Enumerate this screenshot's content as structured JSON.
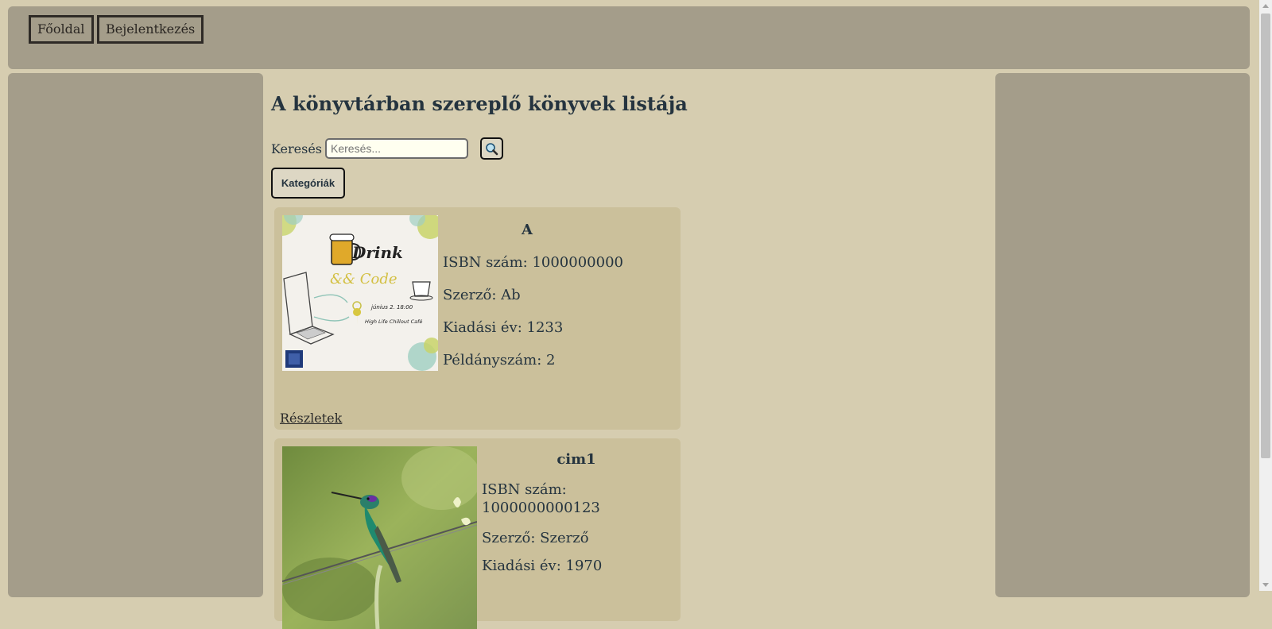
{
  "nav": {
    "home_label": "Főoldal",
    "login_label": "Bejelentkezés"
  },
  "main": {
    "title": "A könyvtárban szereplő könyvek listája",
    "search": {
      "label": "Keresés",
      "placeholder": "Keresés...",
      "button_icon": "search-icon"
    },
    "categories_label": "Kategóriák"
  },
  "books": [
    {
      "title": "A",
      "isbn": "ISBN szám: 1000000000",
      "author": "Szerző: Ab",
      "year": "Kiadási év: 1233",
      "copies": "Példányszám: 2",
      "details_label": "Részletek",
      "cover": {
        "heading": "Drink",
        "subheading": "&& Code",
        "date_text": "június 2. 18:00",
        "place_text": "High Life Chillout Café"
      }
    },
    {
      "title": "cim1",
      "isbn_line1": "ISBN szám:",
      "isbn_line2": "1000000000123",
      "author": "Szerző: Szerző",
      "year": "Kiadási év: 1970"
    }
  ],
  "colors": {
    "page_bg": "#d6cdb0",
    "panel_bg": "#a49d8a",
    "card_bg": "#cbc09b",
    "input_bg": "#fffff0",
    "text": "#25343f"
  }
}
